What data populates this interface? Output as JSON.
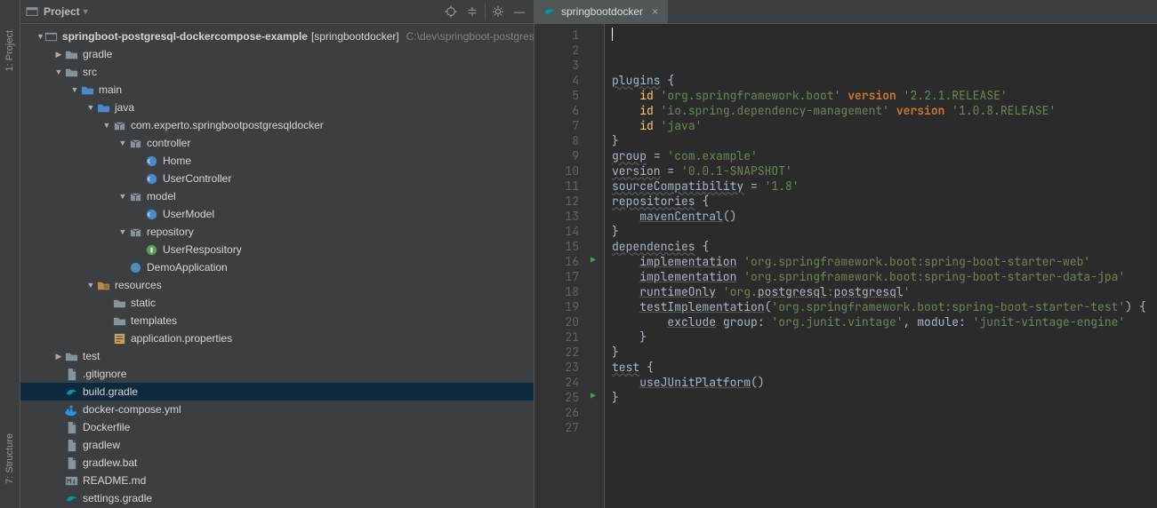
{
  "rail": {
    "items": [
      "1: Project",
      "7: Structure"
    ]
  },
  "sidebar": {
    "title": "Project",
    "toolbar": [
      "locate",
      "collapse",
      "settings",
      "hide"
    ],
    "rows": [
      {
        "indent": 0,
        "arrow": "down",
        "icon": "module",
        "label": "springboot-postgresql-dockercompose-example",
        "extra1": "[springbootdocker]",
        "extra2": "C:\\dev\\springboot-postgresql-dockercompose-example"
      },
      {
        "indent": 1,
        "arrow": "right",
        "icon": "folder",
        "label": "gradle"
      },
      {
        "indent": 1,
        "arrow": "down",
        "icon": "folder",
        "label": "src"
      },
      {
        "indent": 2,
        "arrow": "down",
        "icon": "folder-blue",
        "label": "main"
      },
      {
        "indent": 3,
        "arrow": "down",
        "icon": "folder-blue",
        "label": "java"
      },
      {
        "indent": 4,
        "arrow": "down",
        "icon": "package",
        "label": "com.experto.springbootpostgresqldocker"
      },
      {
        "indent": 5,
        "arrow": "down",
        "icon": "package",
        "label": "controller"
      },
      {
        "indent": 6,
        "arrow": "",
        "icon": "class",
        "label": "Home"
      },
      {
        "indent": 6,
        "arrow": "",
        "icon": "class",
        "label": "UserController"
      },
      {
        "indent": 5,
        "arrow": "down",
        "icon": "package",
        "label": "model"
      },
      {
        "indent": 6,
        "arrow": "",
        "icon": "class",
        "label": "UserModel"
      },
      {
        "indent": 5,
        "arrow": "down",
        "icon": "package",
        "label": "repository"
      },
      {
        "indent": 6,
        "arrow": "",
        "icon": "interface",
        "label": "UserRespository"
      },
      {
        "indent": 5,
        "arrow": "",
        "icon": "run",
        "label": "DemoApplication"
      },
      {
        "indent": 3,
        "arrow": "down",
        "icon": "resources",
        "label": "resources"
      },
      {
        "indent": 4,
        "arrow": "",
        "icon": "folder",
        "label": "static"
      },
      {
        "indent": 4,
        "arrow": "",
        "icon": "folder",
        "label": "templates"
      },
      {
        "indent": 4,
        "arrow": "",
        "icon": "properties",
        "label": "application.properties"
      },
      {
        "indent": 1,
        "arrow": "right",
        "icon": "folder",
        "label": "test"
      },
      {
        "indent": 1,
        "arrow": "",
        "icon": "file",
        "label": ".gitignore"
      },
      {
        "indent": 1,
        "arrow": "",
        "icon": "gradle",
        "label": "build.gradle",
        "selected": true
      },
      {
        "indent": 1,
        "arrow": "",
        "icon": "docker",
        "label": "docker-compose.yml"
      },
      {
        "indent": 1,
        "arrow": "",
        "icon": "file",
        "label": "Dockerfile"
      },
      {
        "indent": 1,
        "arrow": "",
        "icon": "file",
        "label": "gradlew"
      },
      {
        "indent": 1,
        "arrow": "",
        "icon": "file",
        "label": "gradlew.bat"
      },
      {
        "indent": 1,
        "arrow": "",
        "icon": "markdown",
        "label": "README.md"
      },
      {
        "indent": 1,
        "arrow": "",
        "icon": "gradle",
        "label": "settings.gradle"
      }
    ]
  },
  "tab": {
    "label": "springbootdocker"
  },
  "editor": {
    "lineCount": 27,
    "runMarks": [
      16,
      25
    ],
    "lines": [
      {
        "n": 1,
        "seg": [
          {
            "t": ""
          }
        ]
      },
      {
        "n": 2,
        "seg": [
          {
            "c": "id",
            "t": "plugins"
          },
          {
            "t": " {"
          }
        ]
      },
      {
        "n": 3,
        "seg": [
          {
            "t": "    "
          },
          {
            "c": "fn",
            "t": "id"
          },
          {
            "t": " "
          },
          {
            "c": "str",
            "t": "'org.springframework.boot'"
          },
          {
            "t": " "
          },
          {
            "c": "kw",
            "t": "version"
          },
          {
            "t": " "
          },
          {
            "c": "str",
            "t": "'2.2.1.RELEASE'"
          }
        ]
      },
      {
        "n": 4,
        "seg": [
          {
            "t": "    "
          },
          {
            "c": "fn",
            "t": "id"
          },
          {
            "t": " "
          },
          {
            "c": "str",
            "t": "'io.spring.dependency-management'"
          },
          {
            "t": " "
          },
          {
            "c": "kw",
            "t": "version"
          },
          {
            "t": " "
          },
          {
            "c": "str",
            "t": "'1.0.8.RELEASE'"
          }
        ]
      },
      {
        "n": 5,
        "seg": [
          {
            "t": "    "
          },
          {
            "c": "fn",
            "t": "id"
          },
          {
            "t": " "
          },
          {
            "c": "str",
            "t": "'java'"
          }
        ]
      },
      {
        "n": 6,
        "seg": [
          {
            "t": "}"
          }
        ]
      },
      {
        "n": 7,
        "seg": [
          {
            "t": ""
          }
        ]
      },
      {
        "n": 8,
        "seg": [
          {
            "c": "id",
            "t": "group"
          },
          {
            "t": " = "
          },
          {
            "c": "str",
            "t": "'com.example'"
          }
        ]
      },
      {
        "n": 9,
        "seg": [
          {
            "c": "id",
            "t": "version"
          },
          {
            "t": " = "
          },
          {
            "c": "str",
            "t": "'0.0.1-SNAPSHOT'"
          }
        ]
      },
      {
        "n": 10,
        "seg": [
          {
            "c": "id",
            "t": "sourceCompatibility"
          },
          {
            "t": " = "
          },
          {
            "c": "str",
            "t": "'1.8'"
          }
        ]
      },
      {
        "n": 11,
        "seg": [
          {
            "t": ""
          }
        ]
      },
      {
        "n": 12,
        "seg": [
          {
            "c": "id",
            "t": "repositories"
          },
          {
            "t": " {"
          }
        ]
      },
      {
        "n": 13,
        "seg": [
          {
            "t": "    "
          },
          {
            "c": "lk",
            "t": "mavenCentral"
          },
          {
            "t": "()"
          }
        ]
      },
      {
        "n": 14,
        "seg": [
          {
            "t": "}"
          }
        ]
      },
      {
        "n": 15,
        "seg": [
          {
            "t": ""
          }
        ]
      },
      {
        "n": 16,
        "seg": [
          {
            "c": "id",
            "t": "dependencies"
          },
          {
            "t": " {"
          }
        ]
      },
      {
        "n": 17,
        "seg": [
          {
            "t": "    "
          },
          {
            "c": "lk",
            "t": "implementation"
          },
          {
            "t": " "
          },
          {
            "c": "str",
            "t": "'org.springframework.boot:spring-boot-starter-web'"
          }
        ]
      },
      {
        "n": 18,
        "seg": [
          {
            "t": "    "
          },
          {
            "c": "lk",
            "t": "implementation"
          },
          {
            "t": " "
          },
          {
            "c": "str",
            "t": "'org.springframework.boot:spring-boot-starter-data-jpa'"
          }
        ]
      },
      {
        "n": 19,
        "seg": [
          {
            "t": "    "
          },
          {
            "c": "lk",
            "t": "runtimeOnly"
          },
          {
            "t": " "
          },
          {
            "c": "str",
            "t": "'org."
          },
          {
            "c": "pkg",
            "t": "postgresql"
          },
          {
            "c": "str",
            "t": ":"
          },
          {
            "c": "pkg",
            "t": "postgresql"
          },
          {
            "c": "str",
            "t": "'"
          }
        ]
      },
      {
        "n": 20,
        "seg": [
          {
            "t": "    "
          },
          {
            "c": "lk",
            "t": "testImplementation"
          },
          {
            "t": "("
          },
          {
            "c": "str",
            "t": "'org.springframework.boot:spring-boot-starter-test'"
          },
          {
            "t": ") {"
          }
        ]
      },
      {
        "n": 21,
        "seg": [
          {
            "t": "        "
          },
          {
            "c": "lk",
            "t": "exclude"
          },
          {
            "t": " group: "
          },
          {
            "c": "str",
            "t": "'org.junit.vintage'"
          },
          {
            "t": ", module: "
          },
          {
            "c": "str",
            "t": "'junit-vintage-engine'"
          }
        ]
      },
      {
        "n": 22,
        "seg": [
          {
            "t": "    }"
          }
        ]
      },
      {
        "n": 23,
        "seg": [
          {
            "t": "}"
          }
        ]
      },
      {
        "n": 24,
        "seg": [
          {
            "t": ""
          }
        ]
      },
      {
        "n": 25,
        "seg": [
          {
            "c": "id",
            "t": "test"
          },
          {
            "t": " {"
          }
        ]
      },
      {
        "n": 26,
        "seg": [
          {
            "t": "    "
          },
          {
            "c": "lk",
            "t": "useJUnitPlatform"
          },
          {
            "t": "()"
          }
        ]
      },
      {
        "n": 27,
        "seg": [
          {
            "t": "}"
          }
        ]
      }
    ]
  }
}
